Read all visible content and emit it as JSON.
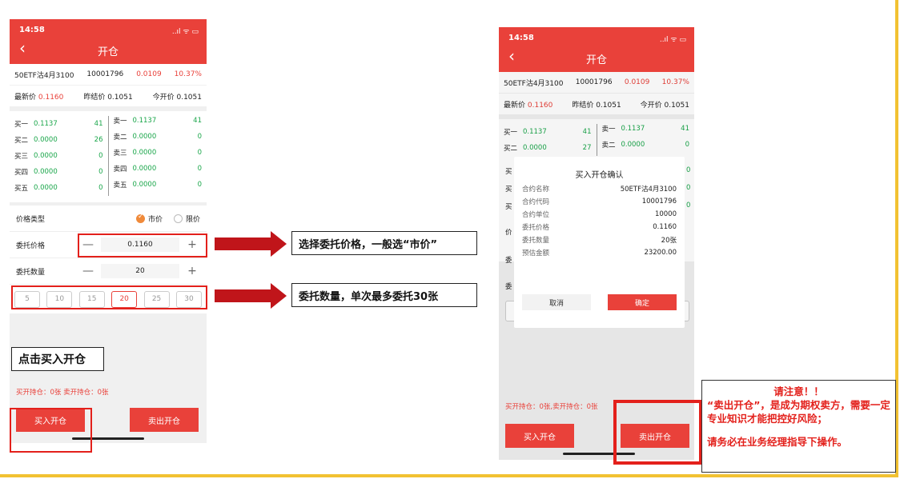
{
  "screen1": {
    "time": "14:58",
    "status_icons": "..ıl ᯤ ▭",
    "title": "开仓",
    "contract": {
      "name": "50ETF沽4月3100",
      "code": "10001796",
      "price": "0.0109",
      "change": "10.37%"
    },
    "prices": {
      "latest_label": "最新价",
      "latest": "0.1160",
      "prev_settle": "昨结价 0.1051",
      "open": "今开价 0.1051"
    },
    "book": {
      "bids": [
        {
          "label": "买一",
          "price": "0.1137",
          "qty": "41"
        },
        {
          "label": "买二",
          "price": "0.0000",
          "qty": "26"
        },
        {
          "label": "买三",
          "price": "0.0000",
          "qty": "0"
        },
        {
          "label": "买四",
          "price": "0.0000",
          "qty": "0"
        },
        {
          "label": "买五",
          "price": "0.0000",
          "qty": "0"
        }
      ],
      "asks": [
        {
          "label": "卖一",
          "price": "0.1137",
          "qty": "41"
        },
        {
          "label": "卖二",
          "price": "0.0000",
          "qty": "0"
        },
        {
          "label": "卖三",
          "price": "0.0000",
          "qty": "0"
        },
        {
          "label": "卖四",
          "price": "0.0000",
          "qty": "0"
        },
        {
          "label": "卖五",
          "price": "0.0000",
          "qty": "0"
        }
      ]
    },
    "price_type": {
      "label": "价格类型",
      "market": "市价",
      "limit": "限价"
    },
    "order_price": {
      "label": "委托价格",
      "minus": "—",
      "value": "0.1160",
      "plus": "+"
    },
    "order_qty": {
      "label": "委托数量",
      "minus": "—",
      "value": "20",
      "plus": "+"
    },
    "qty_options": [
      "5",
      "10",
      "15",
      "20",
      "25",
      "30"
    ],
    "holdings": "买开持仓：0张 卖开持仓：0张",
    "buy_button": "买入开仓",
    "sell_button": "卖出开仓"
  },
  "screen2": {
    "time": "14:58",
    "status_icons": "..ıl ᯤ ▭",
    "title": "开仓",
    "contract": {
      "name": "50ETF沽4月3100",
      "code": "10001796",
      "price": "0.0109",
      "change": "10.37%"
    },
    "prices": {
      "latest_label": "最新价",
      "latest": "0.1160",
      "prev_settle": "昨结价 0.1051",
      "open": "今开价 0.1051"
    },
    "book_rows": [
      {
        "bid_label": "买一",
        "bid_price": "0.1137",
        "bid_qty": "41",
        "ask_label": "卖一",
        "ask_price": "0.1137",
        "ask_qty": "41"
      },
      {
        "bid_label": "买二",
        "bid_price": "0.0000",
        "bid_qty": "27",
        "ask_label": "卖二",
        "ask_price": "0.0000",
        "ask_qty": "0"
      }
    ],
    "side_fragments": [
      "买",
      "买",
      "买",
      "价",
      "委",
      "委"
    ],
    "side_qty_fragments": [
      "0",
      "0",
      "0"
    ],
    "holdings": "买开持仓：0张,卖开持仓：0张",
    "buy_button": "买入开仓",
    "sell_button": "卖出开仓",
    "dialog": {
      "title": "买入开仓确认",
      "rows": [
        {
          "k": "合约名称",
          "v": "50ETF沽4月3100"
        },
        {
          "k": "合约代码",
          "v": "10001796"
        },
        {
          "k": "合约单位",
          "v": "10000"
        },
        {
          "k": "委托价格",
          "v": "0.1160"
        },
        {
          "k": "委托数量",
          "v": "20张"
        },
        {
          "k": "预估金额",
          "v": "23200.00"
        }
      ],
      "cancel": "取消",
      "confirm": "确定"
    }
  },
  "annotations": {
    "price_note": "选择委托价格，一般选“市价”",
    "qty_note": "委托数量，单次最多委托30张",
    "click_note": "点击买入开仓",
    "warning": {
      "line1": "请注意！！",
      "line2": "“卖出开仓”，是成为期权卖方，需要一定专业知识才能把控好风险；",
      "line3": "请务必在业务经理指导下操作。"
    }
  },
  "colors": {
    "primary": "#e9413a",
    "callout": "#e3201b",
    "frame": "#f2c232",
    "green": "#1aa64a"
  }
}
